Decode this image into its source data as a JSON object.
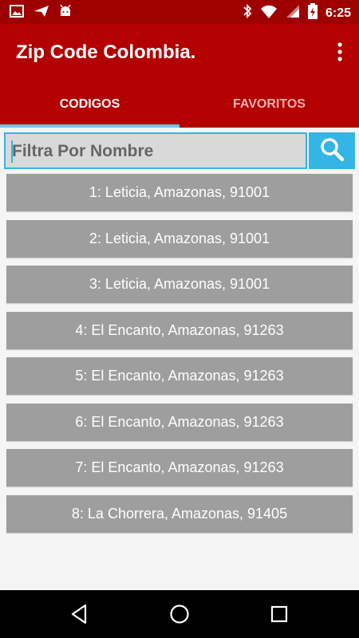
{
  "status_bar": {
    "time": "6:25",
    "left_icons": [
      "image-icon",
      "send-icon",
      "android-icon"
    ],
    "right_icons": [
      "bluetooth-icon",
      "wifi-icon",
      "signal-icon",
      "battery-icon"
    ]
  },
  "app_bar": {
    "title": "Zip Code Colombia.",
    "menu_icon": "more-vert-icon"
  },
  "tabs": [
    {
      "label": "CODIGOS",
      "selected": true
    },
    {
      "label": "FAVORITOS",
      "selected": false
    }
  ],
  "search": {
    "placeholder": "Filtra Por Nombre",
    "value": "",
    "button_icon": "search-icon"
  },
  "list": {
    "items": [
      "1: Leticia, Amazonas, 91001",
      "2: Leticia, Amazonas, 91001",
      "3: Leticia, Amazonas, 91001",
      "4: El Encanto, Amazonas, 91263",
      "5: El Encanto, Amazonas, 91263",
      "6: El Encanto, Amazonas, 91263",
      "7: El Encanto, Amazonas, 91263",
      "8: La Chorrera, Amazonas, 91405"
    ]
  },
  "nav_bar": {
    "buttons": [
      "back-icon",
      "home-icon",
      "recents-icon"
    ]
  },
  "colors": {
    "app_bar": "#b30000",
    "status_bar": "#9e0000",
    "accent": "#33b5e5",
    "list_item": "#9e9e9e"
  }
}
